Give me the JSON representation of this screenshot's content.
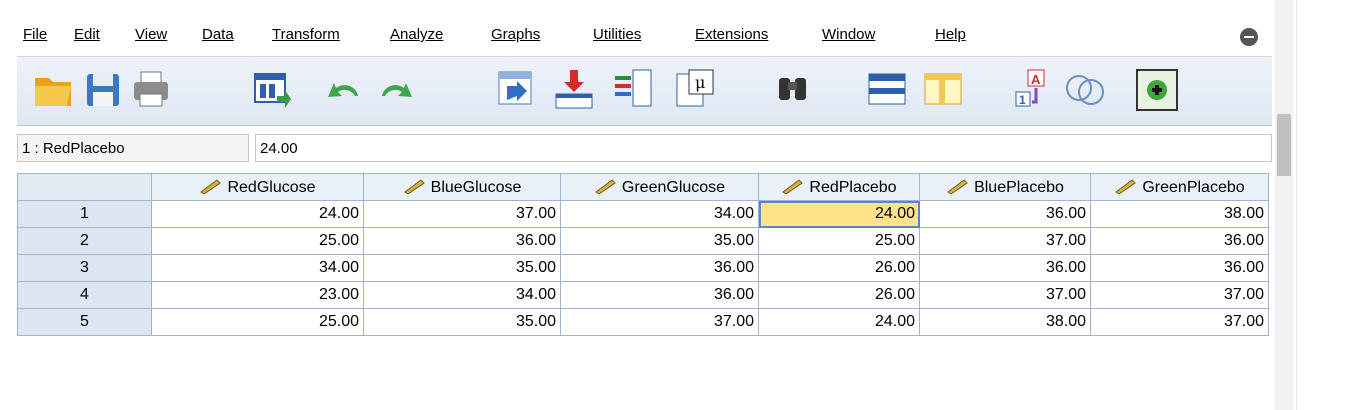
{
  "menu": [
    {
      "label": "File",
      "name": "menu-file"
    },
    {
      "label": "Edit",
      "name": "menu-edit"
    },
    {
      "label": "View",
      "name": "menu-view"
    },
    {
      "label": "Data",
      "name": "menu-data"
    },
    {
      "label": "Transform",
      "name": "menu-transform"
    },
    {
      "label": "Analyze",
      "name": "menu-analyze"
    },
    {
      "label": "Graphs",
      "name": "menu-graphs"
    },
    {
      "label": "Utilities",
      "name": "menu-utilities"
    },
    {
      "label": "Extensions",
      "name": "menu-extensions"
    },
    {
      "label": "Window",
      "name": "menu-window"
    },
    {
      "label": "Help",
      "name": "menu-help"
    }
  ],
  "toolbar_icons": [
    "open-folder-icon",
    "save-icon",
    "print-icon",
    "dialog-recall-icon",
    "undo-icon",
    "redo-icon",
    "goto-case-icon",
    "goto-variable-icon",
    "variables-icon",
    "value-labels-icon",
    "find-icon",
    "insert-cases-icon",
    "insert-variable-icon",
    "split-file-icon",
    "use-sets-icon",
    "add-icon"
  ],
  "cellbar": {
    "ref": "1 : RedPlacebo",
    "value": "24.00"
  },
  "grid": {
    "columns": [
      "RedGlucose",
      "BlueGlucose",
      "GreenGlucose",
      "RedPlacebo",
      "BluePlacebo",
      "GreenPlacebo"
    ],
    "rows": [
      {
        "num": "1",
        "values": [
          "24.00",
          "37.00",
          "34.00",
          "24.00",
          "36.00",
          "38.00"
        ]
      },
      {
        "num": "2",
        "values": [
          "25.00",
          "36.00",
          "35.00",
          "25.00",
          "37.00",
          "36.00"
        ]
      },
      {
        "num": "3",
        "values": [
          "34.00",
          "35.00",
          "36.00",
          "26.00",
          "36.00",
          "36.00"
        ]
      },
      {
        "num": "4",
        "values": [
          "23.00",
          "34.00",
          "36.00",
          "26.00",
          "37.00",
          "37.00"
        ]
      },
      {
        "num": "5",
        "values": [
          "25.00",
          "35.00",
          "37.00",
          "24.00",
          "38.00",
          "37.00"
        ]
      }
    ],
    "selected": {
      "row": 0,
      "col": 3
    }
  }
}
